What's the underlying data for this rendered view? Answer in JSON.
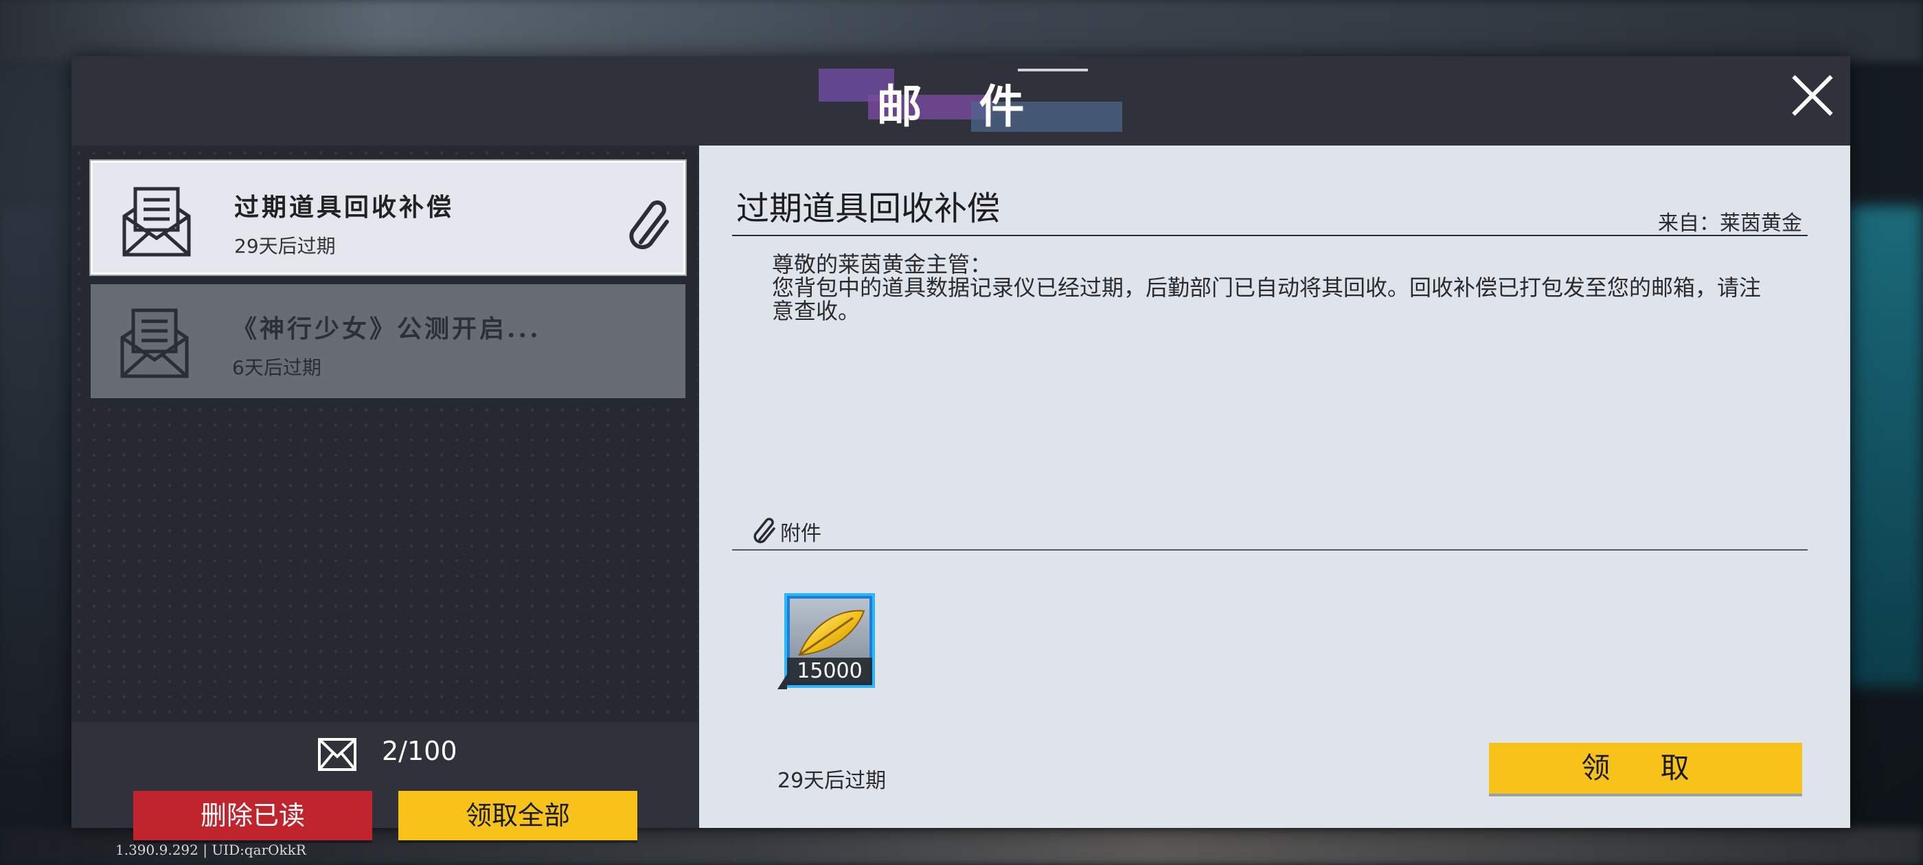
{
  "window": {
    "title": "邮 件"
  },
  "mail_list": [
    {
      "title": "过期道具回收补偿",
      "expire": "29天后过期",
      "has_attachment": true,
      "selected": true
    },
    {
      "title": "《神行少女》公测开启...",
      "expire": "6天后过期",
      "has_attachment": false,
      "selected": false
    }
  ],
  "footer": {
    "mail_count": "2/100",
    "delete_read_label": "删除已读",
    "claim_all_label": "领取全部"
  },
  "detail": {
    "title": "过期道具回收补偿",
    "from": "来自：莱茵黄金",
    "body": "尊敬的莱茵黄金主管：\n您背包中的道具数据记录仪已经过期，后勤部门已自动将其回收。回收补偿已打包发至您的邮箱，请注意查收。",
    "attachment_label": "附件",
    "attachments": [
      {
        "icon": "gold-feather-icon",
        "quantity": "15000"
      }
    ],
    "expire": "29天后过期",
    "claim_label": "领 取"
  },
  "version": "1.390.9.292 | UID:qarOkkR",
  "colors": {
    "red_button": "#c0252d",
    "yellow_button": "#f7c31b",
    "item_frame": "#2bb6ff"
  }
}
